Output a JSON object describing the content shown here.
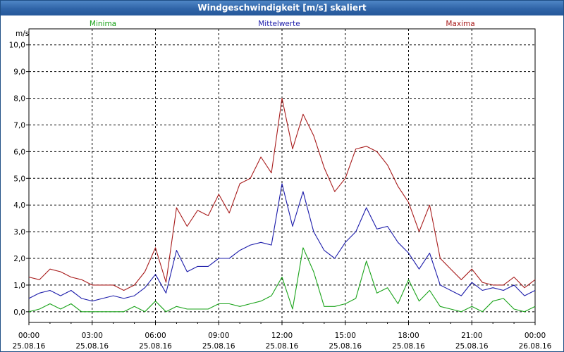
{
  "window": {
    "title": "Windgeschwindigkeit [m/s] skaliert"
  },
  "colors": {
    "minima": "#1aa31a",
    "mittel": "#1c1caa",
    "maxima": "#a81c1c",
    "grid": "#000000",
    "axis": "#000000",
    "titlebar": "#2f64a7"
  },
  "chart_data": {
    "type": "line",
    "title": "Windgeschwindigkeit [m/s] skaliert",
    "ylabel": "m/s",
    "xlabel": "",
    "ylim": [
      -0.4,
      10.6
    ],
    "xlim": [
      0,
      24
    ],
    "grid": true,
    "legend_placement": "top",
    "y_ticks": [
      "0,0",
      "1,0",
      "2,0",
      "3,0",
      "4,0",
      "5,0",
      "6,0",
      "7,0",
      "8,0",
      "9,0",
      "10,0"
    ],
    "x_ticks": [
      {
        "time": "00:00",
        "date": "25.08.16"
      },
      {
        "time": "03:00",
        "date": "25.08.16"
      },
      {
        "time": "06:00",
        "date": "25.08.16"
      },
      {
        "time": "09:00",
        "date": "25.08.16"
      },
      {
        "time": "12:00",
        "date": "25.08.16"
      },
      {
        "time": "15:00",
        "date": "25.08.16"
      },
      {
        "time": "18:00",
        "date": "25.08.16"
      },
      {
        "time": "21:00",
        "date": "25.08.16"
      },
      {
        "time": "00:00",
        "date": "26.08.16"
      }
    ],
    "x_hours": [
      0,
      0.5,
      1,
      1.5,
      2,
      2.5,
      3,
      3.5,
      4,
      4.5,
      5,
      5.5,
      6,
      6.5,
      7,
      7.5,
      8,
      8.5,
      9,
      9.5,
      10,
      10.5,
      11,
      11.5,
      12,
      12.5,
      13,
      13.5,
      14,
      14.5,
      15,
      15.5,
      16,
      16.5,
      17,
      17.5,
      18,
      18.5,
      19,
      19.5,
      20,
      20.5,
      21,
      21.5,
      22,
      22.5,
      23,
      23.5,
      24
    ],
    "series": [
      {
        "name": "Minima",
        "values": [
          0.0,
          0.1,
          0.3,
          0.1,
          0.3,
          0.0,
          0.0,
          0.0,
          0.0,
          0.0,
          0.2,
          0.0,
          0.4,
          0.0,
          0.2,
          0.1,
          0.1,
          0.1,
          0.3,
          0.3,
          0.2,
          0.3,
          0.4,
          0.6,
          1.3,
          0.1,
          2.4,
          1.5,
          0.2,
          0.2,
          0.3,
          0.5,
          1.9,
          0.7,
          0.9,
          0.3,
          1.2,
          0.4,
          0.8,
          0.2,
          0.1,
          0.0,
          0.2,
          0.0,
          0.4,
          0.5,
          0.1,
          0.0,
          0.2
        ]
      },
      {
        "name": "Mittelwerte",
        "values": [
          0.5,
          0.7,
          0.8,
          0.6,
          0.8,
          0.5,
          0.4,
          0.5,
          0.6,
          0.5,
          0.6,
          0.9,
          1.4,
          0.7,
          2.3,
          1.5,
          1.7,
          1.7,
          2.0,
          2.0,
          2.3,
          2.5,
          2.6,
          2.5,
          4.8,
          3.2,
          4.5,
          3.0,
          2.3,
          2.0,
          2.6,
          3.0,
          3.9,
          3.1,
          3.2,
          2.6,
          2.2,
          1.6,
          2.2,
          1.0,
          0.8,
          0.6,
          1.1,
          0.8,
          0.9,
          0.8,
          1.0,
          0.6,
          0.8
        ]
      },
      {
        "name": "Maxima",
        "values": [
          1.3,
          1.2,
          1.6,
          1.5,
          1.3,
          1.2,
          1.0,
          1.0,
          1.0,
          0.8,
          1.0,
          1.5,
          2.4,
          1.1,
          3.9,
          3.2,
          3.8,
          3.6,
          4.4,
          3.7,
          4.8,
          5.0,
          5.8,
          5.2,
          8.0,
          6.1,
          7.4,
          6.6,
          5.4,
          4.5,
          5.0,
          6.1,
          6.2,
          6.0,
          5.5,
          4.7,
          4.1,
          3.0,
          4.0,
          2.0,
          1.6,
          1.2,
          1.6,
          1.1,
          1.0,
          1.0,
          1.3,
          0.9,
          1.2
        ]
      }
    ]
  }
}
